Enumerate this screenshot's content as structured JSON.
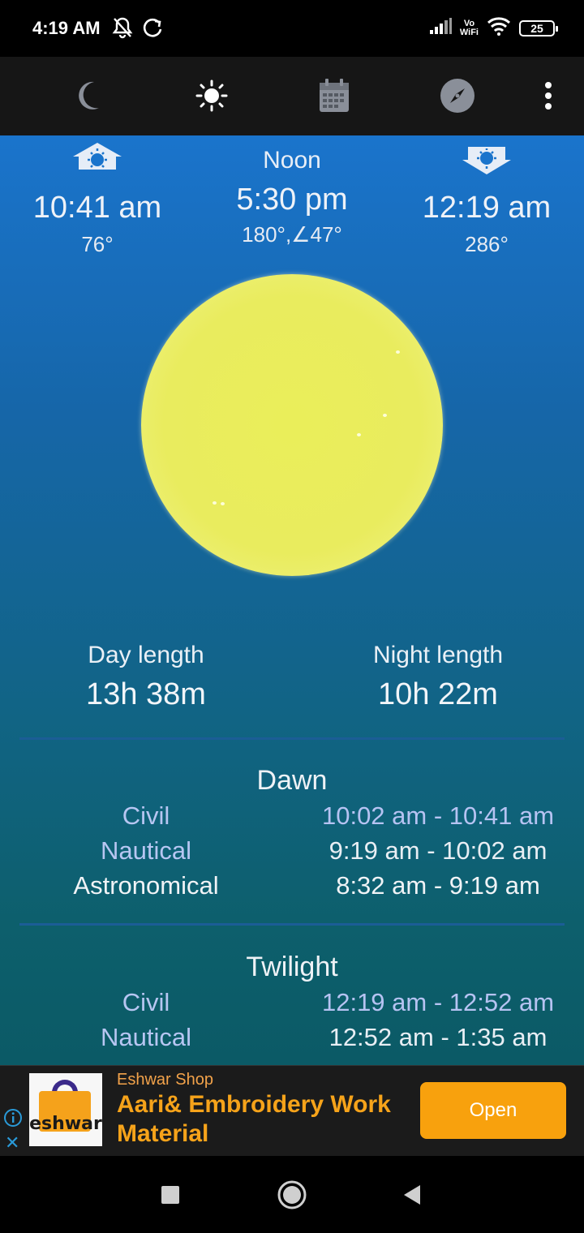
{
  "status_bar": {
    "time": "4:19 AM",
    "vowifi_top": "Vo",
    "vowifi_bottom": "WiFi",
    "battery": "25"
  },
  "toolbar": {
    "icons": [
      "moon-icon",
      "sun-icon",
      "calendar-icon",
      "compass-icon",
      "more-vert-icon"
    ]
  },
  "sun": {
    "sunrise": {
      "time": "10:41 am",
      "azimuth": "76°"
    },
    "noon": {
      "label": "Noon",
      "time": "5:30 pm",
      "position": "180°,∠47°"
    },
    "sunset": {
      "time": "12:19 am",
      "azimuth": "286°"
    }
  },
  "lengths": {
    "day_label": "Day length",
    "day_value": "13h 38m",
    "night_label": "Night length",
    "night_value": "10h 22m"
  },
  "dawn": {
    "title": "Dawn",
    "rows": [
      {
        "label": "Civil",
        "value": "10:02 am - 10:41 am"
      },
      {
        "label": "Nautical",
        "value": "9:19 am - 10:02 am"
      },
      {
        "label": "Astronomical",
        "value": "8:32 am - 9:19 am"
      }
    ]
  },
  "twilight": {
    "title": "Twilight",
    "rows": [
      {
        "label": "Civil",
        "value": "12:19 am - 12:52 am"
      },
      {
        "label": "Nautical",
        "value": "12:52 am - 1:35 am"
      }
    ]
  },
  "ad": {
    "logo_text": "eshwar",
    "shop_name": "Eshwar Shop",
    "headline": "Aari& Embroidery Work Material",
    "button": "Open"
  },
  "colors": {
    "gradient_top": "#1a74cc",
    "gradient_bottom": "#0b5a66",
    "sun": "#eaee5a",
    "ad_accent": "#f8a10d",
    "civil_text": "#b6c3f2"
  }
}
